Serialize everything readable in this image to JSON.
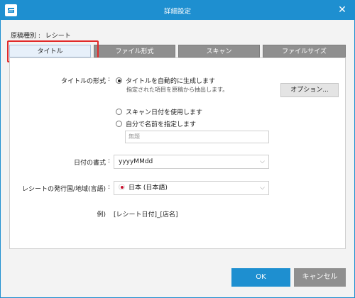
{
  "window": {
    "title": "詳細設定",
    "close_glyph": "✕"
  },
  "document_type": {
    "label": "原稿種別 :",
    "value": "レシート"
  },
  "tabs": [
    {
      "label": "タイトル",
      "active": true
    },
    {
      "label": "ファイル形式",
      "active": false
    },
    {
      "label": "スキャン",
      "active": false
    },
    {
      "label": "ファイルサイズ",
      "active": false
    }
  ],
  "title_format": {
    "label": "タイトルの形式",
    "colon": ":",
    "options": [
      {
        "label": "タイトルを自動的に生成します",
        "selected": true
      },
      {
        "label": "スキャン日付を使用します",
        "selected": false
      },
      {
        "label": "自分で名前を指定します",
        "selected": false
      }
    ],
    "auto_hint": "指定された項目を原稿から抽出します。",
    "options_button": "オプション...",
    "name_placeholder": "無題"
  },
  "date_format": {
    "label": "日付の書式",
    "colon": ":",
    "value": "yyyyMMdd"
  },
  "region": {
    "label": "レシートの発行国/地域(言語)",
    "colon": ":",
    "value": "日本 (日本語)"
  },
  "example": {
    "label": "例)",
    "value": "[レシート日付]_[店名]"
  },
  "footer": {
    "ok": "OK",
    "cancel": "キャンセル"
  },
  "colors": {
    "accent": "#1e8fd0",
    "tab_inactive": "#8f8f8f",
    "highlight": "#e12a2a"
  }
}
